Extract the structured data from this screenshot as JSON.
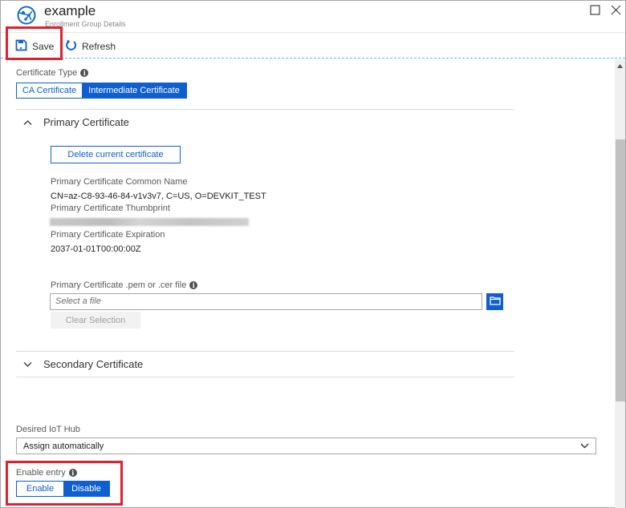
{
  "window": {
    "title": "example",
    "subtitle": "Enrollment Group Details",
    "logo_icon": "iot-hub-network-icon",
    "maximize_icon": "maximize-icon",
    "close_icon": "close-icon"
  },
  "toolbar": {
    "save_label": "Save",
    "save_icon": "save-disk-icon",
    "refresh_label": "Refresh",
    "refresh_icon": "refresh-icon"
  },
  "certificate_type": {
    "label": "Certificate Type",
    "options": [
      "CA Certificate",
      "Intermediate Certificate"
    ],
    "selected": "Intermediate Certificate"
  },
  "primary": {
    "heading": "Primary Certificate",
    "expanded": true,
    "delete_button": "Delete current certificate",
    "common_name_label": "Primary Certificate Common Name",
    "common_name_value": "CN=az-C8-93-46-84-v1v3v7, C=US, O=DEVKIT_TEST",
    "thumbprint_label": "Primary Certificate Thumbprint",
    "thumbprint_value": "(redacted)",
    "expiration_label": "Primary Certificate Expiration",
    "expiration_value": "2037-01-01T00:00:00Z",
    "file_label": "Primary Certificate .pem or .cer file",
    "file_placeholder": "Select a file",
    "clear_button": "Clear Selection"
  },
  "secondary": {
    "heading": "Secondary Certificate",
    "expanded": false
  },
  "iot_hub": {
    "label": "Desired IoT Hub",
    "selected": "Assign automatically"
  },
  "enable_entry": {
    "label": "Enable entry",
    "options": [
      "Enable",
      "Disable"
    ],
    "selected": "Disable"
  },
  "colors": {
    "accent": "#0f5fd0",
    "highlight": "#e0212e",
    "toolbar_dashed": "#4ec3e0"
  }
}
